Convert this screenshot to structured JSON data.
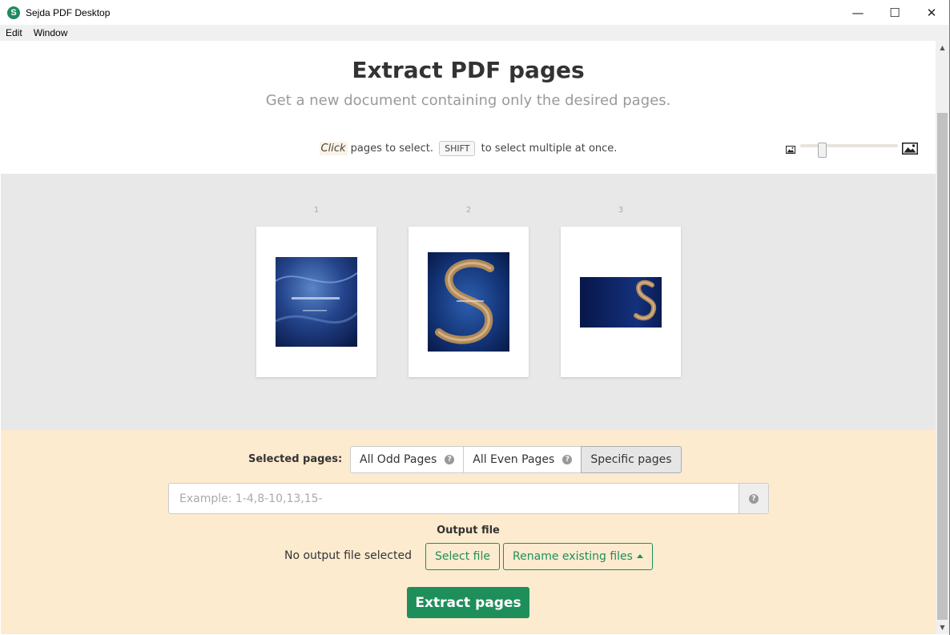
{
  "window": {
    "logo_letter": "S",
    "title": "Sejda PDF Desktop",
    "minimize_glyph": "—",
    "maximize_glyph": "☐",
    "close_glyph": "✕"
  },
  "menu": [
    "Edit",
    "Window"
  ],
  "header": {
    "title": "Extract PDF pages",
    "subtitle": "Get a new document containing only the desired pages.",
    "hint_click": "Click",
    "hint_mid": " pages to select. ",
    "hint_key": "SHIFT",
    "hint_end": " to select multiple at once."
  },
  "zoom": {
    "level": 0.2,
    "small_icon": "image-small-icon",
    "large_icon": "image-large-icon"
  },
  "pages": [
    {
      "number": "1",
      "art": "blue abstract cover",
      "watermark": "SOFTPEDIA"
    },
    {
      "number": "2",
      "art": "blue cover with golden S",
      "watermark": "SOFTPEDIA"
    },
    {
      "number": "3",
      "art": "landscape blue with golden S"
    }
  ],
  "options": {
    "selected_pages_label": "Selected pages:",
    "choices": [
      "All Odd Pages",
      "All Even Pages",
      "Specific pages"
    ],
    "active_choice": "Specific pages",
    "help_glyph": "?",
    "pages_input_placeholder": "Example: 1-4,8-10,13,15-",
    "pages_input_value": "",
    "output_label": "Output file",
    "no_output_text": "No output file selected",
    "select_file_label": "Select file",
    "rename_label": "Rename existing files",
    "extract_label": "Extract pages"
  },
  "colors": {
    "accent": "#1e8f5a",
    "options_bg": "#fdebd0",
    "pages_bg": "#e8e8e8"
  }
}
